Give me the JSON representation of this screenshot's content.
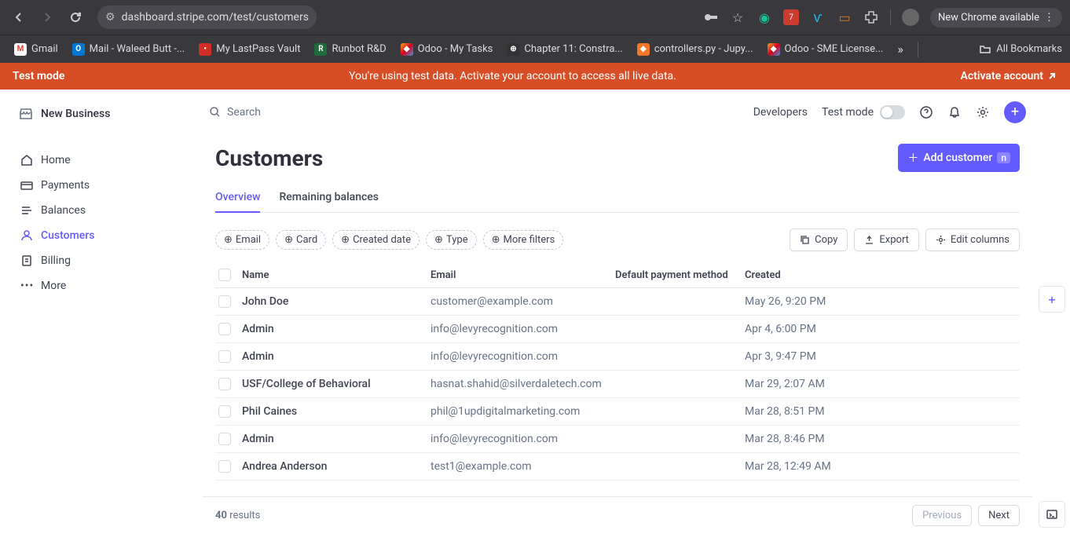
{
  "browser": {
    "url": "dashboard.stripe.com/test/customers",
    "new_chrome": "New Chrome available",
    "bookmarks": [
      {
        "label": "Gmail",
        "bg": "#fff",
        "fg": "#EA4335",
        "t": "M"
      },
      {
        "label": "Mail - Waleed Butt -...",
        "bg": "#0078d4",
        "fg": "#fff",
        "t": "O"
      },
      {
        "label": "My LastPass Vault",
        "bg": "#d32d27",
        "fg": "#fff",
        "t": "•"
      },
      {
        "label": "Runbot R&D",
        "bg": "#1f6b3a",
        "fg": "#fff",
        "t": "R"
      },
      {
        "label": "Odoo - My Tasks",
        "bg": "linear",
        "fg": "#fff",
        "t": "◆"
      },
      {
        "label": "Chapter 11: Constra...",
        "bg": "#333",
        "fg": "#fff",
        "t": "⊕"
      },
      {
        "label": "controllers.py - Jupy...",
        "bg": "#f37726",
        "fg": "#fff",
        "t": "◆"
      },
      {
        "label": "Odoo - SME License...",
        "bg": "linear",
        "fg": "#fff",
        "t": "◆"
      }
    ],
    "all_bookmarks": "All Bookmarks"
  },
  "banner": {
    "left": "Test mode",
    "mid": "You're using test data. Activate your account to access all live data.",
    "right": "Activate account"
  },
  "business": "New Business",
  "sidebar": {
    "items": [
      {
        "label": "Home"
      },
      {
        "label": "Payments"
      },
      {
        "label": "Balances"
      },
      {
        "label": "Customers"
      },
      {
        "label": "Billing"
      },
      {
        "label": "More"
      }
    ]
  },
  "topbar": {
    "search": "Search",
    "developers": "Developers",
    "test_mode": "Test mode"
  },
  "page": {
    "title": "Customers",
    "add_button": "Add customer",
    "kbd": "n",
    "tabs": [
      "Overview",
      "Remaining balances"
    ],
    "filters": [
      "Email",
      "Card",
      "Created date",
      "Type",
      "More filters"
    ],
    "actions": {
      "copy": "Copy",
      "export": "Export",
      "edit": "Edit columns"
    },
    "columns": [
      "Name",
      "Email",
      "Default payment method",
      "Created"
    ],
    "rows": [
      {
        "name": "John Doe",
        "email": "customer@example.com",
        "created": "May 26, 9:20 PM"
      },
      {
        "name": "Admin",
        "email": "info@levyrecognition.com",
        "created": "Apr 4, 6:00 PM"
      },
      {
        "name": "Admin",
        "email": "info@levyrecognition.com",
        "created": "Apr 3, 9:47 PM"
      },
      {
        "name": "USF/College of Behavioral",
        "email": "hasnat.shahid@silverdaletech.com",
        "created": "Mar 29, 2:07 AM"
      },
      {
        "name": "Phil Caines",
        "email": "phil@1updigitalmarketing.com",
        "created": "Mar 28, 8:51 PM"
      },
      {
        "name": "Admin",
        "email": "info@levyrecognition.com",
        "created": "Mar 28, 8:46 PM"
      },
      {
        "name": "Andrea Anderson",
        "email": "test1@example.com",
        "created": "Mar 28, 12:49 AM"
      }
    ],
    "results_count": "40",
    "results_label": "results",
    "prev": "Previous",
    "next": "Next"
  }
}
